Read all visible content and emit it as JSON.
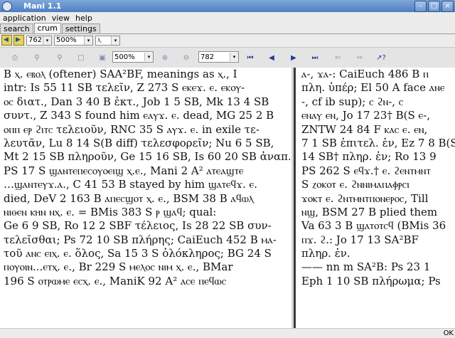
{
  "window": {
    "title": "Mani 1.1"
  },
  "menu": [
    "application",
    "view",
    "help"
  ],
  "tabs": [
    {
      "label": "search",
      "active": false
    },
    {
      "label": "crum",
      "active": true
    },
    {
      "label": "settings",
      "active": false
    }
  ],
  "nav": {
    "page_value": "762",
    "zoom_value": "500%",
    "letter_value": "ⲗ"
  },
  "toolbar": {
    "zoom_value": "500%",
    "page_value": "782"
  },
  "left_column": [
    "B ⲭ. ⲉⲃⲟⲗ (oftener) SAA²BF, meanings as ⲭ., I",
    "intr: Is 55 11 SB τελεῖν, Z 273 S ⲉⲕⲉϫ. ⲉ. ⲉⲕⲟⲩ-",
    "ⲟⲥ διατ., Dan 3 40 B ἐκτ., Job 1 5 SB, Mk 13 4 SB",
    "συντ., Z 343 S found him ⲉⲁⲩϫ. ⲉ. dead, MG 25 2 B",
    "ⲟⲡⲡ ⲉⲣ ϩⲓⲧⲥ τελειοῦν, RNC 35 S ⲁⲩϫ. ⲉ. in exile τε-",
    "λευτᾶν, Lu 8 14 S(B diff) τελεσφορεῖν; Nu 6 5 SB,",
    "Mt 2 15 SB πληροῦν, Ge 15 16 SB, Is 60 20 SB ἀναπ.;",
    "PS 17 S ϣⲁⲛⲧⲉⲡⲉⲥⲟⲩⲟⲉⲓϣ ⲭ.ⲉ., Mani 2 A² ⲁⲧⲉⲁϣⲧⲉ",
    "…ϣⲁⲛⲧⲉⲩϫ.ⲁ., C 41 53 B stayed by him ϣⲁⲧⲉϥϫ. ⲉ.",
    "died, DeV 2 163 B ⲁⲡⲉⲥϣⲟⲧ ⲭ. ⲉ., BSM 38 B ⲁϥⲱⲗ",
    "ⲛⲓⲑⲉⲛ ⲕⲏⲛ ⲛⲭ. ⲉ. = BMis 383 S ⲣ ϣⲁϥ;      qual:",
    "Ge 6 9 SB, Ro 12 2 SBF τέλειος, Is 28 22 SB συν-",
    "τελεῖσθαι; Ps 72 10 SB πλήρης; CaiEuch 452 B ⲙⲁ-",
    "τοῦ ⲁⲛⲥ ⲉⲓⲭ. ⲉ. ὅλος, Sa 15 3 S ὁλόκληρος; BG 24 S",
    "ⲡⲟⲩⲟⲓⲛ...ⲉⲧⲭ. ⲉ., Br 229 S ⲙⲉⲗⲟⲥ ⲛⲓⲙ ⲭ. ⲉ., BMar",
    "196 S ⲟⲧⲣⲱⲙⲉ ⲉⲥⲭ. ⲉ., ManiK 92 A² ⲁⲥⲉ ⲡⲉϥⲱⲥ"
  ],
  "right_column": [
    "ⲁ-, ϫⲁ-: CaiEuch 486 B ⲡ",
    "πλη. ὑπέρ; El 50 A face ⲁⲛⲉ",
    "-, cf ib sup);      ⲥ ϩⲛ-, ⲥ",
    "ⲉⲛⲁⲩ ⲉⲛ, Jo 17 23† B(S ⲉ-,",
    "ZNTW 24 84 F ⲕⲁⲥ ⲉ. ⲉⲛ,",
    "7 1 SB ἐπιτελ. ἐν, Ez 7 8 B(S",
    "14 SB† πληρ. ἐν; Ro 13 9",
    "PS 262 S ⲉϥϫ.† ⲉ. ϩⲉⲛⲧⲙⲛⲧ",
    "S ⲍⲟⲕⲟⲧ ⲉ. ϩⲛⲛⲓⲙⲁⲡⲁⲫⲣⲥⲓ",
    "ϫⲟⲕⲧ ⲉ. ϩⲛⲧⲙⲛⲧⲡⲟⲛⲉⲣⲟⲥ, Till",
    "ⲛϣ, BSM 27 B plied them",
    "Va 63 3 B ϣⲁⲧⲟⲧⲥϥ (BMis 36",
    "ⲡϫ. ϩ.: Jo 17 13 SA²BF",
    "πληρ. ἐν.",
    "—— nn m SA²B: Ps 23 1",
    "Eph 1 10 SB πλήρωμα; Ps"
  ],
  "status": {
    "text": "OK"
  }
}
